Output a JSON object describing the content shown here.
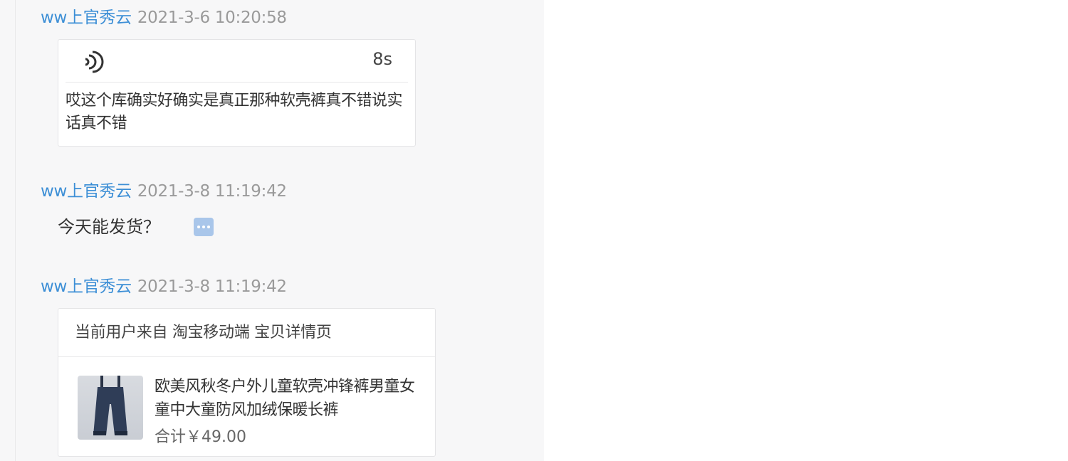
{
  "messages": [
    {
      "sender": "ww上官秀云",
      "time": "2021-3-6 10:20:58",
      "voice": {
        "duration": "8s",
        "transcript": "哎这个库确实好确实是真正那种软壳裤真不错说实话真不错"
      }
    },
    {
      "sender": "ww上官秀云",
      "time": "2021-3-8 11:19:42",
      "text": "今天能发货？"
    },
    {
      "sender": "ww上官秀云",
      "time": "2021-3-8 11:19:42",
      "product": {
        "source": "当前用户来自 淘宝移动端 宝贝详情页",
        "title": "欧美风秋冬户外儿童软壳冲锋裤男童女童中大童防风加绒保暖长裤",
        "price": "合计￥49.00"
      }
    }
  ],
  "icons": {
    "voice": "voice-wave-icon",
    "more": "more-options-icon"
  },
  "colors": {
    "sender": "#3d8fd6",
    "time": "#9a9a9a",
    "panel_bg": "#f7f7f8",
    "more_icon": "#a9c6ea"
  }
}
